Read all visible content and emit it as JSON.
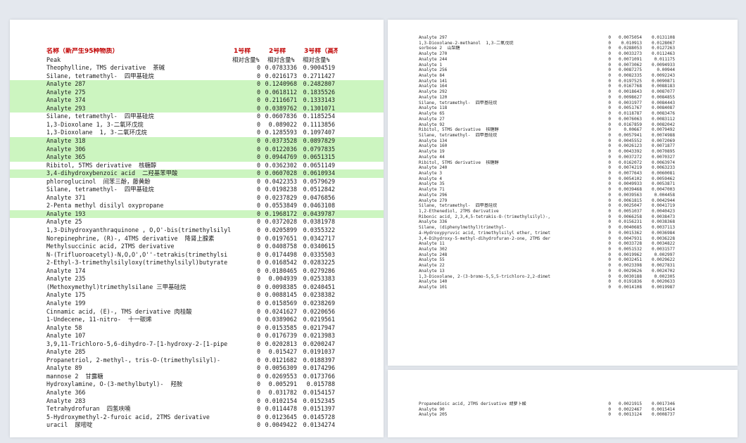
{
  "left_page": {
    "header": {
      "name": "名称（新产生95种物质）",
      "s1": "1号样",
      "s2": "2号样",
      "s3": "3号样（高剂"
    },
    "subheader": {
      "name": "Peak",
      "s1": "相对含量%",
      "s2": "相对含量%",
      "s3": "相对含量%"
    },
    "rows": [
      {
        "name": "Theophylline, TMS derivative  茶碱",
        "v1": "0",
        "v2": "0.0783336",
        "v3": "0.9004519",
        "hl": false
      },
      {
        "name": "Silane, tetramethyl-  四甲基硅烷",
        "v1": "0",
        "v2": "0.0216173",
        "v3": "0.2711427",
        "hl": false
      },
      {
        "name": "Analyte 287",
        "v1": "0",
        "v2": "0.1240968",
        "v3": "0.2482807",
        "hl": true
      },
      {
        "name": "Analyte 275",
        "v1": "0",
        "v2": "0.0618112",
        "v3": "0.1835526",
        "hl": true
      },
      {
        "name": "Analyte 374",
        "v1": "0",
        "v2": "0.2116671",
        "v3": "0.1333143",
        "hl": true
      },
      {
        "name": "Analyte 293",
        "v1": "0",
        "v2": "0.0389762",
        "v3": "0.1301071",
        "hl": true
      },
      {
        "name": "Silane, tetramethyl-  四甲基硅烷",
        "v1": "0",
        "v2": "0.0607836",
        "v3": "0.1185254",
        "hl": false
      },
      {
        "name": "1,3-Dioxolane 1, 3-二氧环戊烷",
        "v1": "0",
        "v2": "0.089022",
        "v3": "0.1113856",
        "hl": false
      },
      {
        "name": "1,3-Dioxolane  1, 3-二氧环戊烷",
        "v1": "0",
        "v2": "0.1285593",
        "v3": "0.1097407",
        "hl": false
      },
      {
        "name": "Analyte 318",
        "v1": "0",
        "v2": "0.0373528",
        "v3": "0.0897829",
        "hl": true
      },
      {
        "name": "Analyte 306",
        "v1": "0",
        "v2": "0.0122036",
        "v3": "0.0797835",
        "hl": true
      },
      {
        "name": "Analyte 365",
        "v1": "0",
        "v2": "0.0944769",
        "v3": "0.0651315",
        "hl": true
      },
      {
        "name": "Ribitol, 5TMS derivative  核糖醇",
        "v1": "0",
        "v2": "0.0362302",
        "v3": "0.0651149",
        "hl": false
      },
      {
        "name": "3,4-dihydroxybenzoic acid  二羟基苯甲酸",
        "v1": "0",
        "v2": "0.0607028",
        "v3": "0.0610934",
        "hl": true
      },
      {
        "name": "phloroglucinol  间苯三酚，藤黄酚",
        "v1": "0",
        "v2": "0.0422353",
        "v3": "0.0579629",
        "hl": false
      },
      {
        "name": "Silane, tetramethyl-  四甲基硅烷",
        "v1": "0",
        "v2": "0.0198238",
        "v3": "0.0512842",
        "hl": false
      },
      {
        "name": "Analyte 371",
        "v1": "0",
        "v2": "0.0237829",
        "v3": "0.0476856",
        "hl": false
      },
      {
        "name": "2-Penta methyl disilyl oxypropane",
        "v1": "0",
        "v2": "0.0553849",
        "v3": "0.0463108",
        "hl": false
      },
      {
        "name": "Analyte 193",
        "v1": "0",
        "v2": "0.1968172",
        "v3": "0.0439787",
        "hl": true
      },
      {
        "name": "Analyte 25",
        "v1": "0",
        "v2": "0.0372028",
        "v3": "0.0381978",
        "hl": false
      },
      {
        "name": "1,3-Dihydroxyanthraquinone , O,O'-bis(trimethylsilyl",
        "v1": "0",
        "v2": "0.0205899",
        "v3": "0.0355322",
        "hl": false
      },
      {
        "name": "Norepinephrine, (R)-, 4TMS derivative  降肾上腺素",
        "v1": "0",
        "v2": "0.0197651",
        "v3": "0.0342717",
        "hl": false
      },
      {
        "name": "Methylsuccinic acid, 2TMS derivative",
        "v1": "0",
        "v2": "0.0408758",
        "v3": "0.0340615",
        "hl": false
      },
      {
        "name": "N-(Trifluoroacetyl)-N,O,O',O''-tetrakis(trimethylsi",
        "v1": "0",
        "v2": "0.0174498",
        "v3": "0.0335503",
        "hl": false
      },
      {
        "name": "2-Ethyl-3-trimethylsilyloxy(trimethylsilyl)butyrate",
        "v1": "0",
        "v2": "0.0168542",
        "v3": "0.0283225",
        "hl": false
      },
      {
        "name": "Analyte 174",
        "v1": "0",
        "v2": "0.0180465",
        "v3": "0.0279286",
        "hl": false
      },
      {
        "name": "Analyte 235",
        "v1": "0",
        "v2": "0.004939",
        "v3": "0.0253383",
        "hl": false
      },
      {
        "name": "(Methoxymethyl)trimethylsilane 三甲基硅烷",
        "v1": "0",
        "v2": "0.0098385",
        "v3": "0.0240451",
        "hl": false
      },
      {
        "name": "Analyte 175",
        "v1": "0",
        "v2": "0.0088145",
        "v3": "0.0238382",
        "hl": false
      },
      {
        "name": "Analyte 199",
        "v1": "0",
        "v2": "0.0158569",
        "v3": "0.0238269",
        "hl": false
      },
      {
        "name": "Cinnamic acid, (E)-, TMS derivative 肉桂酸",
        "v1": "0",
        "v2": "0.0241627",
        "v3": "0.0220656",
        "hl": false
      },
      {
        "name": "1-Undecene, 11-nitro-  十一碳烯",
        "v1": "0",
        "v2": "0.0389062",
        "v3": "0.0219561",
        "hl": false
      },
      {
        "name": "Analyte 58",
        "v1": "0",
        "v2": "0.0153585",
        "v3": "0.0217947",
        "hl": false
      },
      {
        "name": "Analyte 107",
        "v1": "0",
        "v2": "0.0176739",
        "v3": "0.0213983",
        "hl": false
      },
      {
        "name": "3,9,11-Trichloro-5,6-dihydro-7-[1-hydroxy-2-[1-pipe",
        "v1": "0",
        "v2": "0.0202813",
        "v3": "0.0200247",
        "hl": false
      },
      {
        "name": "Analyte 285",
        "v1": "0",
        "v2": "0.015427",
        "v3": "0.0191037",
        "hl": false
      },
      {
        "name": "Propanetriol, 2-methyl-, tris-O-(trimethylsilyl)-",
        "v1": "0",
        "v2": "0.0121682",
        "v3": "0.0188397",
        "hl": false
      },
      {
        "name": "Analyte 89",
        "v1": "0",
        "v2": "0.0056309",
        "v3": "0.0174296",
        "hl": false
      },
      {
        "name": "mannose 2  甘露糖",
        "v1": "0",
        "v2": "0.0269553",
        "v3": "0.0173766",
        "hl": false
      },
      {
        "name": "Hydroxylamine, O-(3-methylbutyl)-  羟胺",
        "v1": "0",
        "v2": "0.005291",
        "v3": "0.015788",
        "hl": false
      },
      {
        "name": "Analyte 366",
        "v1": "0",
        "v2": "0.031782",
        "v3": "0.0154157",
        "hl": false
      },
      {
        "name": "Analyte 283",
        "v1": "0",
        "v2": "0.0102154",
        "v3": "0.0152345",
        "hl": false
      },
      {
        "name": "Tetrahydrofuran  四氢呋喃",
        "v1": "0",
        "v2": "0.0114478",
        "v3": "0.0151397",
        "hl": false
      },
      {
        "name": "5-Hydroxymethyl-2-furoic acid, 2TMS derivative",
        "v1": "0",
        "v2": "0.0123645",
        "v3": "0.0145728",
        "hl": false
      },
      {
        "name": "uracil  尿嘧啶",
        "v1": "0",
        "v2": "0.0049422",
        "v3": "0.0134274",
        "hl": false
      }
    ]
  },
  "right_page_top": {
    "rows": [
      {
        "name": "Analyte 297",
        "v1": "0",
        "v2": "0.0075054",
        "v3": "0.0131108"
      },
      {
        "name": "1,3-Dioxolane-2-methanol  1,3-二氧戊烷",
        "v1": "0",
        "v2": "0.010913",
        "v3": "0.0128067"
      },
      {
        "name": "sorbose 2  山梨糖",
        "v1": "0",
        "v2": "0.0288053",
        "v3": "0.0127263"
      },
      {
        "name": "Analyte 270",
        "v1": "0",
        "v2": "0.0033273",
        "v3": "0.0112463"
      },
      {
        "name": "Analyte 244",
        "v1": "0",
        "v2": "0.0071091",
        "v3": "0.011175"
      },
      {
        "name": "Analyte 1",
        "v1": "0",
        "v2": "0.0073062",
        "v3": "0.0094933"
      },
      {
        "name": "Analyte 256",
        "v1": "0",
        "v2": "0.0087275",
        "v3": "0.00944"
      },
      {
        "name": "Analyte 84",
        "v1": "0",
        "v2": "0.0082335",
        "v3": "0.0092243"
      },
      {
        "name": "Analyte 141",
        "v1": "0",
        "v2": "0.0197525",
        "v3": "0.0090871"
      },
      {
        "name": "Analyte 164",
        "v1": "0",
        "v2": "0.0167768",
        "v3": "0.0088183"
      },
      {
        "name": "Analyte 292",
        "v1": "0",
        "v2": "0.0018643",
        "v3": "0.0087077"
      },
      {
        "name": "Analyte 120",
        "v1": "0",
        "v2": "0.0098627",
        "v3": "0.0084855"
      },
      {
        "name": "Silane, tetramethyl-  四甲基硅烷",
        "v1": "0",
        "v2": "0.0031977",
        "v3": "0.0084443"
      },
      {
        "name": "Analyte 118",
        "v1": "0",
        "v2": "0.0051767",
        "v3": "0.0084087"
      },
      {
        "name": "Analyte 65",
        "v1": "0",
        "v2": "0.0118787",
        "v3": "0.0083476"
      },
      {
        "name": "Analyte 27",
        "v1": "0",
        "v2": "0.0076063",
        "v3": "0.0083112"
      },
      {
        "name": "Analyte 92",
        "v1": "0",
        "v2": "0.0167859",
        "v3": "0.0082042"
      },
      {
        "name": "Ribitol, 5TMS derivative  核糖醇",
        "v1": "0",
        "v2": "0.00667",
        "v3": "0.0079492"
      },
      {
        "name": "Silane, tetramethyl-  四甲基硅烷",
        "v1": "0",
        "v2": "0.0057941",
        "v3": "0.0074988"
      },
      {
        "name": "Analyte 134",
        "v1": "0",
        "v2": "0.0045552",
        "v3": "0.0072069"
      },
      {
        "name": "Analyte 160",
        "v1": "0",
        "v2": "0.0026123",
        "v3": "0.0071877"
      },
      {
        "name": "Analyte 19",
        "v1": "0",
        "v2": "0.0043392",
        "v3": "0.0070895"
      },
      {
        "name": "Analyte 44",
        "v1": "0",
        "v2": "0.0037272",
        "v3": "0.0070327"
      },
      {
        "name": "Ribitol, 5TMS derivative  核糖醇",
        "v1": "0",
        "v2": "0.0162072",
        "v3": "0.0063974"
      },
      {
        "name": "Analyte 240",
        "v1": "0",
        "v2": "0.0074219",
        "v3": "0.0063233"
      },
      {
        "name": "Analyte 3",
        "v1": "0",
        "v2": "0.0077643",
        "v3": "0.0060081"
      },
      {
        "name": "Analyte 4",
        "v1": "0",
        "v2": "0.0054102",
        "v3": "0.0059462"
      },
      {
        "name": "Analyte 35",
        "v1": "0",
        "v2": "0.0049933",
        "v3": "0.0053871"
      },
      {
        "name": "Analyte 71",
        "v1": "0",
        "v2": "0.0039468",
        "v3": "0.0047003"
      },
      {
        "name": "Analyte 296",
        "v1": "0",
        "v2": "0.0039563",
        "v3": "0.004458"
      },
      {
        "name": "Analyte 279",
        "v1": "0",
        "v2": "0.0061815",
        "v3": "0.0042944"
      },
      {
        "name": "Silane, tetramethyl-  四甲基硅烷",
        "v1": "0",
        "v2": "0.0025047",
        "v3": "0.0041719"
      },
      {
        "name": "1,2-Ethenediol, 2TMS derivative",
        "v1": "0",
        "v2": "0.0051037",
        "v3": "0.0040423"
      },
      {
        "name": "Ribonic acid, 2,3,4,5-tetrakis-O-(trimethylsilyl)-,",
        "v1": "0",
        "v2": "0.0066258",
        "v3": "0.0038473"
      },
      {
        "name": "Analyte 336",
        "v1": "0",
        "v2": "0.0156231",
        "v3": "0.0038368"
      },
      {
        "name": "Silane, (diphenylmethyl)trimethyl-",
        "v1": "0",
        "v2": "0.0040685",
        "v3": "0.0037113"
      },
      {
        "name": "á-Hydroxypyruvic acid, trimethylsilyl ether, trimet",
        "v1": "0",
        "v2": "0.0015362",
        "v3": "0.0036984"
      },
      {
        "name": "3,4-Dihydroxy-5-methyl-dihydrofuran-2-one, 2TMS der",
        "v1": "0",
        "v2": "0.0047931",
        "v3": "0.0036228"
      },
      {
        "name": "Analyte 11",
        "v1": "0",
        "v2": "0.0033728",
        "v3": "0.0034822"
      },
      {
        "name": "Analyte 302",
        "v1": "0",
        "v2": "0.0051532",
        "v3": "0.0031577"
      },
      {
        "name": "Analyte 248",
        "v1": "0",
        "v2": "0.0019962",
        "v3": "0.002997"
      },
      {
        "name": "Analyte 55",
        "v1": "0",
        "v2": "0.0032451",
        "v3": "0.0029622"
      },
      {
        "name": "Analyte 22",
        "v1": "0",
        "v2": "0.0023398",
        "v3": "0.0027831"
      },
      {
        "name": "Analyte 13",
        "v1": "0",
        "v2": "0.0029626",
        "v3": "0.0024702"
      },
      {
        "name": "1,3-Dioxolane, 2-(3-bromo-5,5,5-trichloro-2,2-dimet",
        "v1": "0",
        "v2": "0.0030188",
        "v3": "0.002305"
      },
      {
        "name": "Analyte 140",
        "v1": "0",
        "v2": "0.0191836",
        "v3": "0.0020633"
      },
      {
        "name": "Analyte 101",
        "v1": "0",
        "v2": "0.0014108",
        "v3": "0.0019987"
      }
    ]
  },
  "right_page_bottom": {
    "rows": [
      {
        "name": "Propanedioic acid, 2TMS derivative 胡萝卜酸",
        "v1": "0",
        "v2": "0.0021915",
        "v3": "0.0017346"
      },
      {
        "name": "Analyte 90",
        "v1": "0",
        "v2": "0.0022467",
        "v3": "0.0015414"
      },
      {
        "name": "Analyte 205",
        "v1": "0",
        "v2": "0.0013124",
        "v3": "0.0008737"
      }
    ]
  }
}
